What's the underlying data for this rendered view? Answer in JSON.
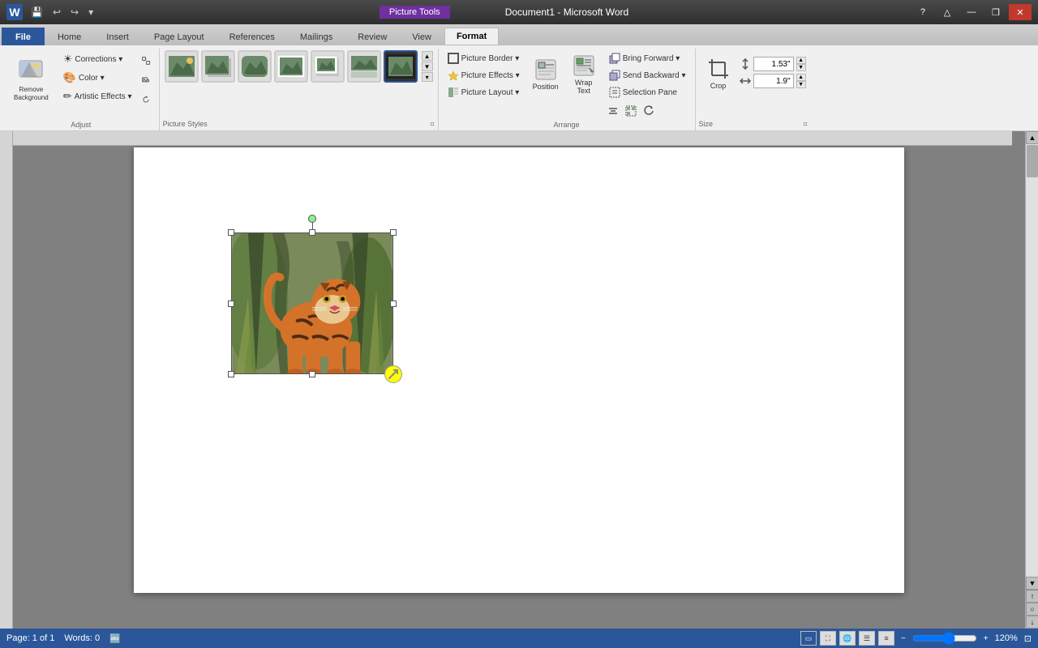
{
  "app": {
    "title": "Document1 - Microsoft Word",
    "picture_tools_label": "Picture Tools",
    "logo": "W"
  },
  "title_bar": {
    "quick_access": [
      "💾",
      "↩",
      "↪",
      "⬇"
    ],
    "win_buttons": [
      "—",
      "❐",
      "✕"
    ]
  },
  "tabs": [
    {
      "id": "file",
      "label": "File",
      "type": "file"
    },
    {
      "id": "home",
      "label": "Home",
      "type": "normal"
    },
    {
      "id": "insert",
      "label": "Insert",
      "type": "normal"
    },
    {
      "id": "page-layout",
      "label": "Page Layout",
      "type": "normal"
    },
    {
      "id": "references",
      "label": "References",
      "type": "normal"
    },
    {
      "id": "mailings",
      "label": "Mailings",
      "type": "normal"
    },
    {
      "id": "review",
      "label": "Review",
      "type": "normal"
    },
    {
      "id": "view",
      "label": "View",
      "type": "normal"
    },
    {
      "id": "format",
      "label": "Format",
      "type": "active"
    }
  ],
  "ribbon": {
    "groups": [
      {
        "id": "adjust",
        "label": "Adjust",
        "buttons": [
          {
            "id": "remove-bg",
            "label": "Remove\nBackground",
            "icon": "🖼"
          },
          {
            "id": "corrections",
            "label": "Corrections ▾",
            "icon": "☀"
          },
          {
            "id": "color",
            "label": "Color ▾",
            "icon": "🎨"
          },
          {
            "id": "artistic-effects",
            "label": "Artistic Effects ▾",
            "icon": "✏"
          },
          {
            "id": "compress",
            "label": "",
            "icon": "⊞"
          },
          {
            "id": "change-picture",
            "label": "",
            "icon": "📷"
          },
          {
            "id": "reset-picture",
            "label": "",
            "icon": "↺"
          }
        ]
      },
      {
        "id": "picture-styles",
        "label": "Picture Styles",
        "styles_count": 7,
        "launcher": "⌗"
      },
      {
        "id": "arrange",
        "label": "Arrange",
        "buttons": [
          {
            "id": "picture-border",
            "label": "Picture Border ▾",
            "icon": "▭"
          },
          {
            "id": "picture-effects",
            "label": "Picture Effects ▾",
            "icon": "✦"
          },
          {
            "id": "picture-layout",
            "label": "Picture Layout ▾",
            "icon": "▤"
          },
          {
            "id": "position",
            "label": "Position",
            "icon": "📌"
          },
          {
            "id": "wrap-text",
            "label": "Wrap\nText",
            "icon": "⟺"
          },
          {
            "id": "bring-forward",
            "label": "Bring Forward ▾",
            "icon": "⬆"
          },
          {
            "id": "send-backward",
            "label": "Send Backward ▾",
            "icon": "⬇"
          },
          {
            "id": "selection-pane",
            "label": "Selection Pane",
            "icon": "☰"
          },
          {
            "id": "align",
            "label": "",
            "icon": "⊞"
          },
          {
            "id": "group",
            "label": "",
            "icon": "⊡"
          },
          {
            "id": "rotate",
            "label": "",
            "icon": "↻"
          }
        ]
      },
      {
        "id": "size",
        "label": "Size",
        "buttons": [
          {
            "id": "crop",
            "label": "Crop",
            "icon": "✂"
          }
        ],
        "height_label": "Height",
        "width_label": "Width",
        "height_value": "1.53\"",
        "width_value": "1.9\""
      }
    ]
  },
  "document": {
    "page_info": "Page: 1 of 1",
    "words": "Words: 0",
    "zoom": "120%"
  },
  "status_bar": {
    "page": "Page: 1 of 1",
    "words": "Words: 0",
    "zoom": "120%",
    "views": [
      "print",
      "full-screen",
      "web",
      "outline",
      "draft"
    ]
  }
}
